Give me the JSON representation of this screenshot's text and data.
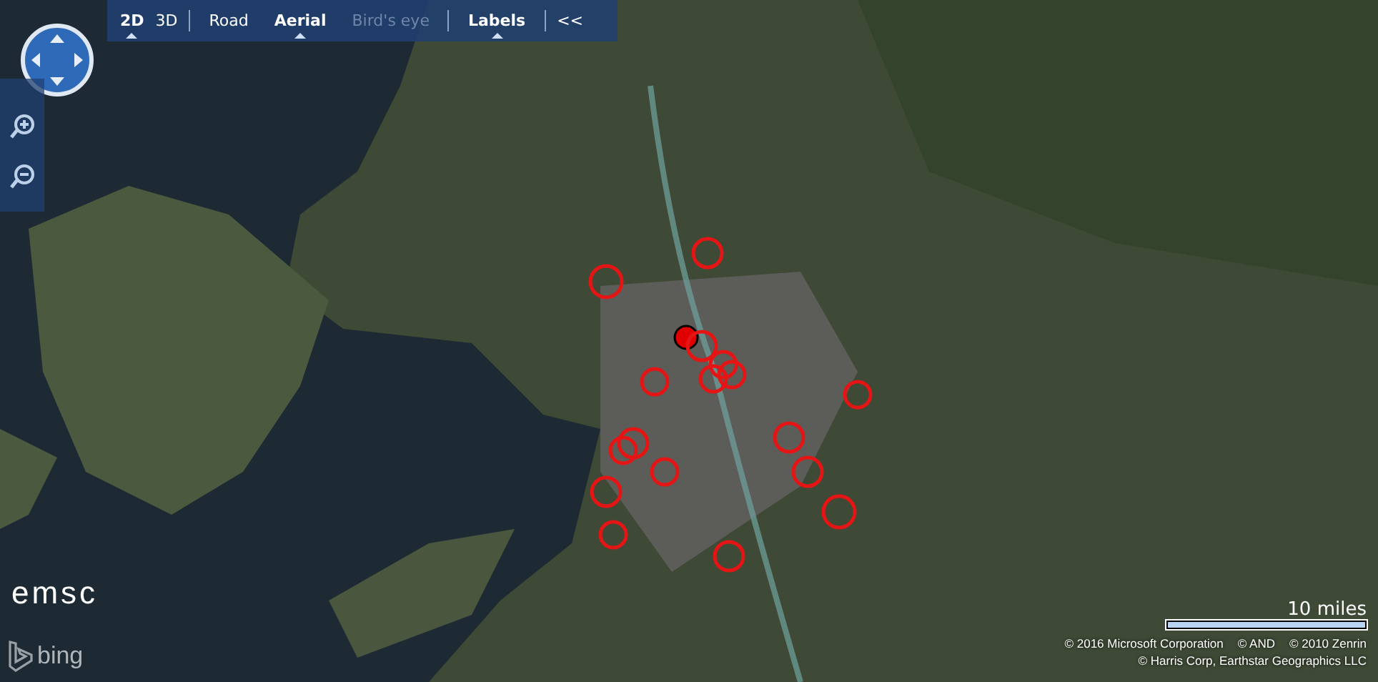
{
  "toolbar": {
    "view_modes": [
      {
        "label": "2D",
        "selected": true
      },
      {
        "label": "3D",
        "selected": false
      }
    ],
    "map_styles": [
      {
        "label": "Road",
        "selected": false,
        "disabled": false
      },
      {
        "label": "Aerial",
        "selected": true,
        "disabled": false
      },
      {
        "label": "Bird's eye",
        "selected": false,
        "disabled": true
      }
    ],
    "labels": {
      "label": "Labels",
      "on": true
    },
    "collapse": "<<"
  },
  "markers": [
    {
      "selected": false
    },
    {
      "selected": false
    },
    {
      "selected": true
    },
    {
      "selected": false
    },
    {
      "selected": false
    },
    {
      "selected": false
    },
    {
      "selected": false
    },
    {
      "selected": false
    },
    {
      "selected": false
    },
    {
      "selected": false
    },
    {
      "selected": false
    },
    {
      "selected": false
    },
    {
      "selected": false
    },
    {
      "selected": false
    },
    {
      "selected": false
    },
    {
      "selected": false
    },
    {
      "selected": false
    },
    {
      "selected": false
    }
  ],
  "logo": "emsc",
  "bing_logo": "bing",
  "scale": {
    "label": "10 miles"
  },
  "copyright": [
    "© 2016 Microsoft Corporation",
    "© AND",
    "© 2010 Zenrin",
    "© Harris Corp, Earthstar Geographics LLC"
  ]
}
